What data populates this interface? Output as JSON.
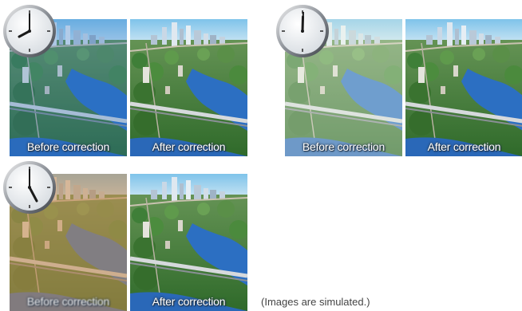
{
  "groups": [
    {
      "time_label": "8 o'clock",
      "before_caption": "Before correction",
      "after_caption": "After correction",
      "before_tint": "#3a7dbf"
    },
    {
      "time_label": "12 o'clock",
      "before_caption": "Before correction",
      "after_caption": "After correction",
      "before_tint": "#e8f2dc"
    },
    {
      "time_label": "5 o'clock",
      "before_caption": "Before correction",
      "after_caption": "After correction",
      "before_tint": "#d9a46a"
    }
  ],
  "note": "(Images are simulated.)",
  "icons": [
    "clock-icon"
  ]
}
